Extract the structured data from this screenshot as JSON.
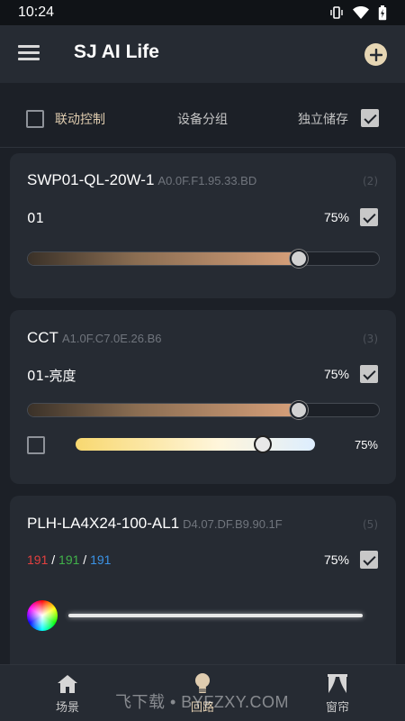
{
  "status": {
    "time": "10:24"
  },
  "app": {
    "title": "SJ AI Life"
  },
  "toolbar": {
    "link_label": "联动控制",
    "link_checked": false,
    "group_label": "设备分组",
    "store_label": "独立储存",
    "store_checked": true
  },
  "devices": [
    {
      "name": "SWP01-QL-20W-1",
      "mac": "A0.0F.F1.95.33.BD",
      "index": "(2)",
      "channel": "01",
      "percent": "75%",
      "level": 0.75,
      "checked": true
    },
    {
      "name": "CCT",
      "mac": "A1.0F.C7.0E.26.B6",
      "index": "(3)",
      "channel": "01-亮度",
      "percent": "75%",
      "level": 0.75,
      "checked": true,
      "cct_percent": "75%",
      "cct_level": 0.75,
      "cct_checked": false
    },
    {
      "name": "PLH-LA4X24-100-AL1",
      "mac": "D4.07.DF.B9.90.1F",
      "index": "(5)",
      "rgb": {
        "r": "191",
        "g": "191",
        "b": "191",
        "sep": "/"
      },
      "percent": "75%",
      "checked": true
    }
  ],
  "nav": [
    {
      "label": "场景",
      "icon": "house-icon"
    },
    {
      "label": "回路",
      "icon": "bulb-icon"
    },
    {
      "label": "窗帘",
      "icon": "curtain-icon"
    }
  ],
  "watermark": "飞下载 • BYFZXY.COM",
  "colors": {
    "accent": "#e0cdb0",
    "background": "#1c2027",
    "card": "#262b33"
  }
}
